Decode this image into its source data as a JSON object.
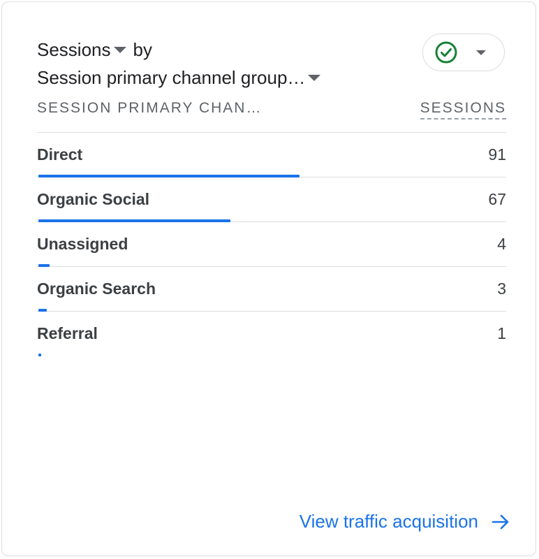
{
  "card": {
    "metric_label": "Sessions",
    "by_label": "by",
    "dimension_label": "Session primary channel group…",
    "status_icon": "check-circle-icon"
  },
  "table": {
    "dimension_header": "SESSION PRIMARY CHAN…",
    "metric_header": "SESSIONS",
    "rows": [
      {
        "label": "Direct",
        "value": 91
      },
      {
        "label": "Organic Social",
        "value": 67
      },
      {
        "label": "Unassigned",
        "value": 4
      },
      {
        "label": "Organic Search",
        "value": 3
      },
      {
        "label": "Referral",
        "value": 1
      }
    ],
    "bar_color": "#1a73e8"
  },
  "footer": {
    "link_label": "View traffic acquisition",
    "link_icon": "arrow-right-icon",
    "link_color": "#1a73e8"
  },
  "colors": {
    "success_green": "#188038",
    "accent_blue": "#1a73e8"
  }
}
